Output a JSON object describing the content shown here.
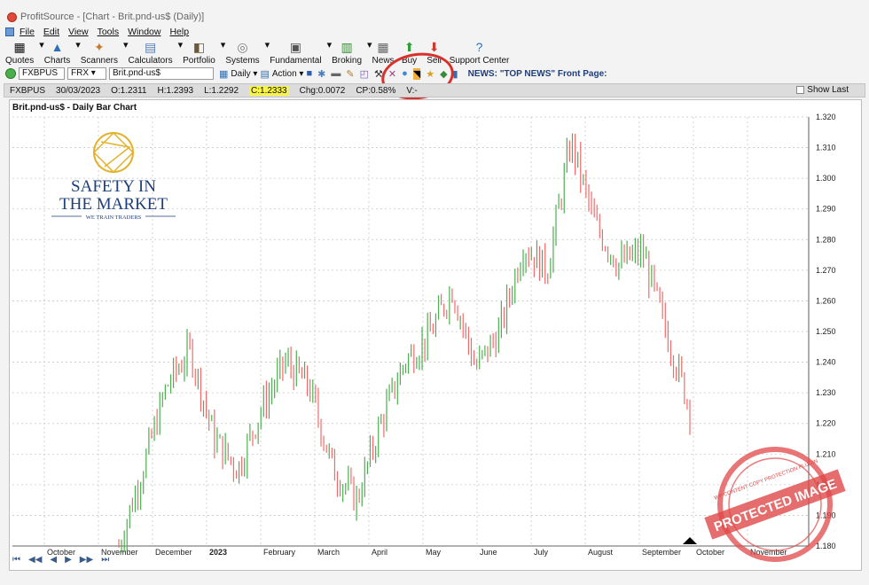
{
  "window": {
    "title": "ProfitSource - [Chart - Brit.pnd-us$ (Daily)]"
  },
  "menu": [
    "File",
    "Edit",
    "View",
    "Tools",
    "Window",
    "Help"
  ],
  "toolbar": {
    "items": [
      {
        "label": "Quotes",
        "icon": "quotes-icon"
      },
      {
        "label": "Charts",
        "icon": "charts-icon"
      },
      {
        "label": "Scanners",
        "icon": "scanners-icon"
      },
      {
        "label": "Calculators",
        "icon": "calculator-icon"
      },
      {
        "label": "Portfolio",
        "icon": "portfolio-icon"
      },
      {
        "label": "Systems",
        "icon": "systems-icon"
      },
      {
        "label": "Fundamental",
        "icon": "fundamental-icon"
      },
      {
        "label": "Broking",
        "icon": "broking-icon"
      },
      {
        "label": "News",
        "icon": "news-icon"
      },
      {
        "label": "Buy",
        "icon": "buy-icon"
      },
      {
        "label": "Sell",
        "icon": "sell-icon"
      },
      {
        "label": "Support Center",
        "icon": "support-icon"
      }
    ]
  },
  "symbolbar": {
    "symbol": "FXBPUS",
    "exchange": "FRX",
    "name": "Brit.pnd-us$",
    "period": "Daily",
    "action": "Action",
    "news": "NEWS: \"TOP NEWS\" Front Page:"
  },
  "infobar": {
    "symbol": "FXBPUS",
    "date": "30/03/2023",
    "open": "O:1.2311",
    "high": "H:1.2393",
    "low": "L:1.2292",
    "close": "C:1.2333",
    "chg": "Chg:0.0072",
    "cp": "CP:0.58%",
    "v": "V:-",
    "show_last": "Show Last"
  },
  "chart": {
    "title": "Brit.pnd-us$ - Daily Bar Chart"
  },
  "logo": {
    "line1": "SAFETY IN",
    "line2": "THE MARKET",
    "tagline": "WE TRAIN TRADERS"
  },
  "stamp": {
    "text": "PROTECTED IMAGE",
    "arc_text": "WP CONTENT COPY PROTECTION PLUGIN"
  },
  "colors": {
    "up": "#4caf50",
    "down": "#f26b6b",
    "highlight": "#f7f34a",
    "annotation": "#d9302b",
    "stamp": "#e04848"
  },
  "chart_data": {
    "type": "bar",
    "title": "Brit.pnd-us$ - Daily Bar Chart",
    "x_labels": [
      "October",
      "November",
      "December",
      "2023",
      "February",
      "March",
      "April",
      "May",
      "June",
      "July",
      "August",
      "September",
      "October",
      "November"
    ],
    "y_ticks": [
      "1.320",
      "1.310",
      "1.300",
      "1.290",
      "1.280",
      "1.270",
      "1.260",
      "1.250",
      "1.240",
      "1.230",
      "1.220",
      "1.210",
      "1.200",
      "1.190",
      "1.180"
    ],
    "ylim": [
      1.18,
      1.32
    ],
    "grid": true,
    "series": [
      {
        "x": "November",
        "close": 1.18
      },
      {
        "x": "November",
        "close": 1.205
      },
      {
        "x": "December",
        "close": 1.232
      },
      {
        "x": "December",
        "close": 1.244
      },
      {
        "x": "December",
        "close": 1.215
      },
      {
        "x": "December",
        "close": 1.205
      },
      {
        "x": "2023",
        "close": 1.225
      },
      {
        "x": "2023",
        "close": 1.24
      },
      {
        "x": "February",
        "close": 1.232
      },
      {
        "x": "February",
        "close": 1.205
      },
      {
        "x": "March",
        "close": 1.195
      },
      {
        "x": "March",
        "close": 1.22
      },
      {
        "x": "April",
        "close": 1.24
      },
      {
        "x": "April",
        "close": 1.248
      },
      {
        "x": "May",
        "close": 1.264
      },
      {
        "x": "May",
        "close": 1.238
      },
      {
        "x": "June",
        "close": 1.25
      },
      {
        "x": "June",
        "close": 1.278
      },
      {
        "x": "June",
        "close": 1.27
      },
      {
        "x": "July",
        "close": 1.312
      },
      {
        "x": "July",
        "close": 1.285
      },
      {
        "x": "August",
        "close": 1.272
      },
      {
        "x": "August",
        "close": 1.276
      },
      {
        "x": "September",
        "close": 1.25
      },
      {
        "x": "September",
        "close": 1.225
      }
    ]
  }
}
